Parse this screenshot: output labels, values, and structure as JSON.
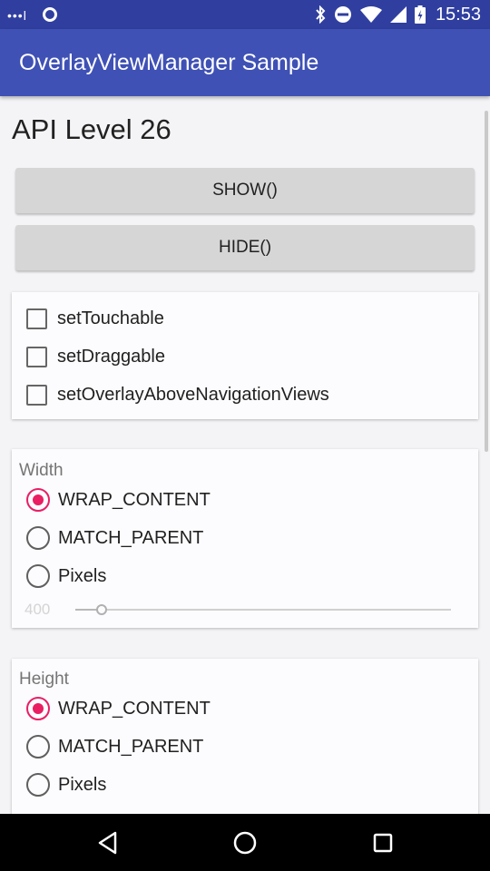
{
  "status_bar": {
    "time": "15:53",
    "signal_dots": "•••l",
    "icons": [
      "signal-dots-icon",
      "app-notification-icon",
      "bluetooth-icon",
      "do-not-disturb-icon",
      "wifi-icon",
      "cellular-icon",
      "battery-icon"
    ]
  },
  "app_bar": {
    "title": "OverlayViewManager Sample"
  },
  "main": {
    "api_level": "API Level 26",
    "show_button": "SHOW()",
    "hide_button": "HIDE()",
    "options": [
      {
        "label": "setTouchable",
        "checked": false
      },
      {
        "label": "setDraggable",
        "checked": false
      },
      {
        "label": "setOverlayAboveNavigationViews",
        "checked": false
      }
    ],
    "width": {
      "title": "Width",
      "options": [
        {
          "label": "WRAP_CONTENT",
          "selected": true
        },
        {
          "label": "MATCH_PARENT",
          "selected": false
        },
        {
          "label": "Pixels",
          "selected": false
        }
      ],
      "pixels_value": "400",
      "slider_fraction": 0.07
    },
    "height": {
      "title": "Height",
      "options": [
        {
          "label": "WRAP_CONTENT",
          "selected": true
        },
        {
          "label": "MATCH_PARENT",
          "selected": false
        },
        {
          "label": "Pixels",
          "selected": false
        }
      ]
    }
  },
  "colors": {
    "status_bar": "#303f9f",
    "app_bar": "#3f51b5",
    "accent": "#e91e63"
  },
  "nav_bar": {
    "icons": [
      "back-icon",
      "home-icon",
      "recents-icon"
    ]
  }
}
